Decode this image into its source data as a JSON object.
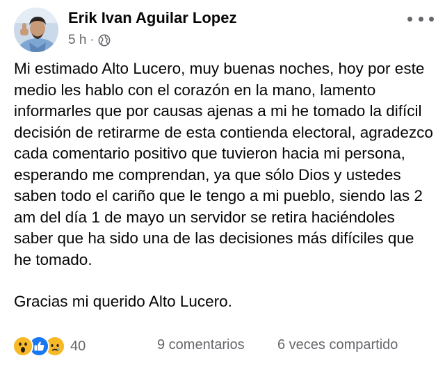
{
  "post": {
    "author_name": "Erik Ivan Aguilar Lopez",
    "timestamp": "5 h",
    "separator": "·",
    "audience_icon": "globe-icon",
    "options_icon": "more-horizontal-icon",
    "body_paragraphs": [
      "Mi estimado Alto Lucero, muy buenas noches, hoy por este medio les hablo con el corazón en la mano, lamento informarles que por causas ajenas a mi he tomado la difícil decisión de retirarme de esta contienda electoral, agradezco cada comentario positivo que tuvieron hacia mi persona, esperando me comprendan, ya que sólo Dios y ustedes saben todo el cariño que le tengo a mi pueblo, siendo las 2 am del día 1 de mayo un servidor se retira haciéndoles saber que ha sido una de las decisiones más difíciles que he tomado.",
      "Gracias mi querido Alto Lucero."
    ]
  },
  "footer": {
    "reaction_icons": [
      "wow-reaction-icon",
      "like-reaction-icon",
      "sad-reaction-icon"
    ],
    "reaction_count": "40",
    "comments": "9 comentarios",
    "shares": "6 veces compartido"
  },
  "colors": {
    "text_primary": "#050505",
    "text_secondary": "#65676b",
    "like_blue": "#1877f2",
    "emoji_yellow": "#f7b928"
  }
}
